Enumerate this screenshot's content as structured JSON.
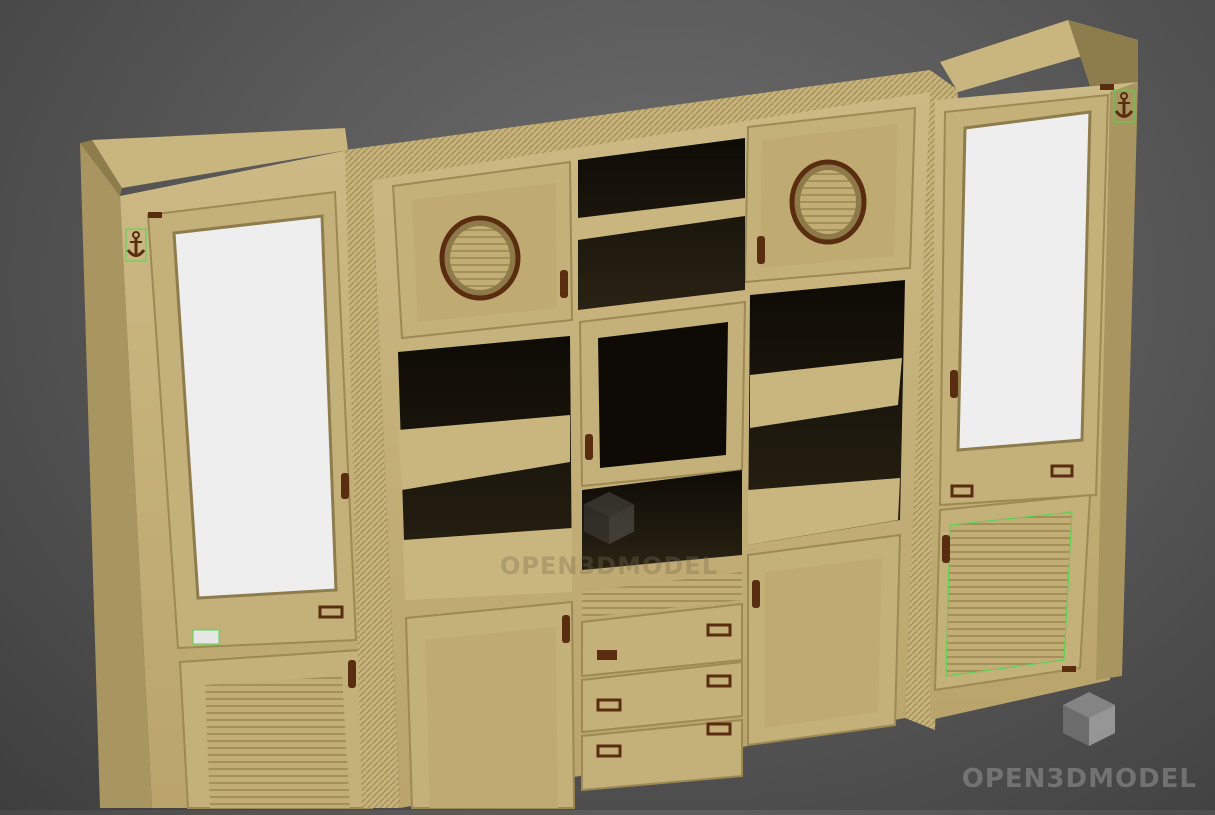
{
  "scene": {
    "subject": "3d-furniture-render",
    "colors": {
      "background": "#5a5a5a",
      "wood": "#c9b57e",
      "wood_dark": "#a8955f",
      "wood_shadow": "#7d6c3f",
      "cavity": "#120f08",
      "glass": "#eeeeee",
      "hardware": "#5a2c10",
      "selection_green": "#4fd84f"
    },
    "icons": [
      "anchor-icon",
      "porthole-icon",
      "drawer-pull-icon",
      "door-handle-icon",
      "watermark-cube-icon"
    ]
  },
  "watermark": {
    "text": "OPEN3DMODEL"
  }
}
